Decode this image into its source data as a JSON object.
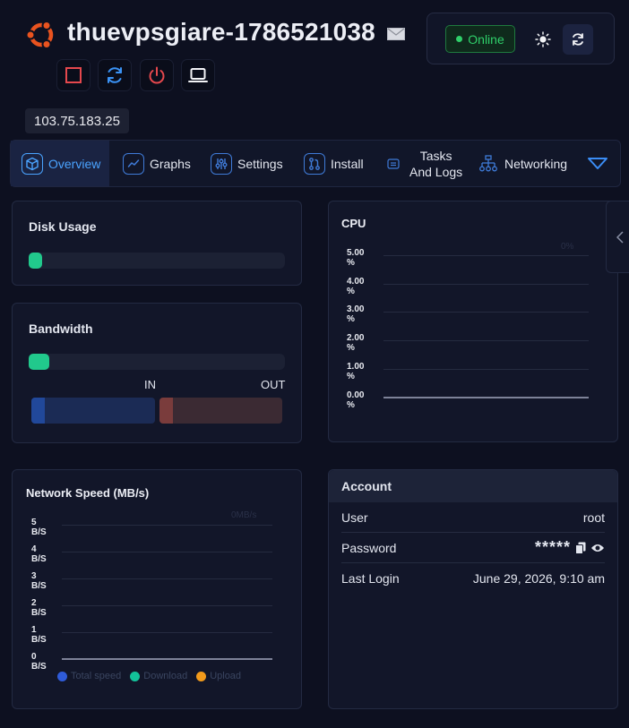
{
  "header": {
    "server_name": "thuevpsgiare-1786521038",
    "status": "Online",
    "ip": "103.75.183.25",
    "icons": [
      "ubuntu-logo-icon",
      "mail-icon",
      "sun-icon",
      "refresh-icon",
      "stop-icon",
      "restart-icon",
      "power-icon",
      "console-icon"
    ]
  },
  "tabs": [
    {
      "label": "Overview",
      "icon": "cube-icon",
      "active": true
    },
    {
      "label": "Graphs",
      "icon": "chart-line-icon"
    },
    {
      "label": "Settings",
      "icon": "sliders-icon"
    },
    {
      "label": "Install",
      "icon": "git-icon"
    },
    {
      "label_line1": "Tasks",
      "label_line2": "And Logs",
      "icon": "list-icon"
    },
    {
      "label": "Networking",
      "icon": "network-icon"
    }
  ],
  "disk": {
    "title": "Disk Usage",
    "fraction": 0.0
  },
  "bandwidth": {
    "title": "Bandwidth",
    "fraction": 0.0,
    "in_label": "IN",
    "out_label": "OUT"
  },
  "cpu": {
    "title": "CPU",
    "chart_data": {
      "type": "line",
      "title": "CPU",
      "y_ticks": [
        "5.00 %",
        "4.00 %",
        "3.00 %",
        "2.00 %",
        "1.00 %",
        "0.00 %"
      ],
      "ylim": [
        0,
        5
      ],
      "series": [
        {
          "values": [
            0,
            0
          ]
        }
      ],
      "faint_label": "0%"
    }
  },
  "network": {
    "title": "Network Speed (MB/s)",
    "chart_data": {
      "type": "line",
      "title": "Network Speed (MB/s)",
      "y_ticks": [
        "5 B/S",
        "4 B/S",
        "3 B/S",
        "2 B/S",
        "1 B/S",
        "0 B/S"
      ],
      "ylim": [
        0,
        5
      ],
      "series": [
        {
          "name": "Total speed",
          "color": "#2f5bd8",
          "values": [
            0,
            0
          ]
        },
        {
          "name": "Download",
          "color": "#13c29a",
          "values": [
            0,
            0
          ]
        },
        {
          "name": "Upload",
          "color": "#f29a1b",
          "values": [
            0,
            0
          ]
        }
      ],
      "faint_label": "0MB/s"
    }
  },
  "account": {
    "title": "Account",
    "rows": [
      {
        "label": "User",
        "value": "root"
      },
      {
        "label": "Password",
        "value": "*****"
      },
      {
        "label": "Last Login",
        "value": "June 29, 2026, 9:10 am"
      }
    ]
  }
}
